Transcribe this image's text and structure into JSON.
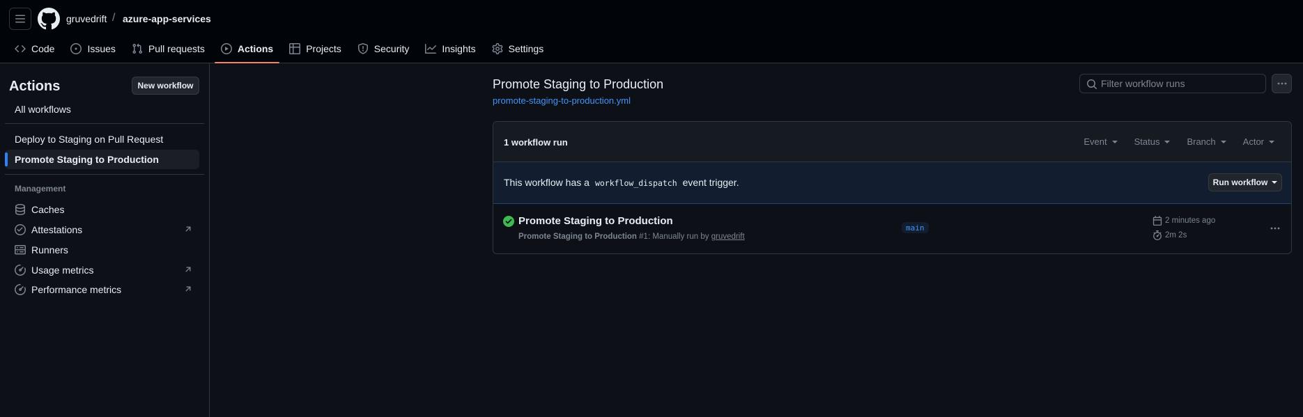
{
  "header": {
    "owner": "gruvedrift",
    "separator": "/",
    "repo": "azure-app-services"
  },
  "repo_nav": {
    "tabs": [
      {
        "label": "Code",
        "icon": "code-icon"
      },
      {
        "label": "Issues",
        "icon": "issue-opened-icon"
      },
      {
        "label": "Pull requests",
        "icon": "git-pull-request-icon"
      },
      {
        "label": "Actions",
        "icon": "play-icon",
        "active": true
      },
      {
        "label": "Projects",
        "icon": "table-icon"
      },
      {
        "label": "Security",
        "icon": "shield-icon"
      },
      {
        "label": "Insights",
        "icon": "graph-icon"
      },
      {
        "label": "Settings",
        "icon": "gear-icon"
      }
    ]
  },
  "sidebar": {
    "title": "Actions",
    "new_workflow": "New workflow",
    "all_workflows": "All workflows",
    "workflows": [
      "Deploy to Staging on Pull Request",
      "Promote Staging to Production"
    ],
    "management_heading": "Management",
    "management": [
      {
        "label": "Caches",
        "icon": "database-icon"
      },
      {
        "label": "Attestations",
        "icon": "verified-icon",
        "external": true
      },
      {
        "label": "Runners",
        "icon": "server-icon"
      },
      {
        "label": "Usage metrics",
        "icon": "meter-icon",
        "external": true
      },
      {
        "label": "Performance metrics",
        "icon": "meter-icon",
        "external": true
      }
    ]
  },
  "main": {
    "title": "Promote Staging to Production",
    "workflow_file": "promote-staging-to-production.yml",
    "filter_placeholder": "Filter workflow runs",
    "run_count": "1 workflow run",
    "filters": [
      "Event",
      "Status",
      "Branch",
      "Actor"
    ],
    "dispatch": {
      "prefix": "This workflow has a",
      "code": "workflow_dispatch",
      "suffix": "event trigger.",
      "button": "Run workflow"
    },
    "run": {
      "title": "Promote Staging to Production",
      "meta_name": "Promote Staging to Production",
      "meta_text": "#1: Manually run by",
      "actor": "gruvedrift",
      "branch": "main",
      "when": "2 minutes ago",
      "duration": "2m 2s",
      "status": "success"
    }
  },
  "colors": {
    "background": "#0d1117",
    "header_bg": "#010409",
    "accent": "#4493f8",
    "active_tab_underline": "#f78166",
    "success": "#3fb950"
  }
}
